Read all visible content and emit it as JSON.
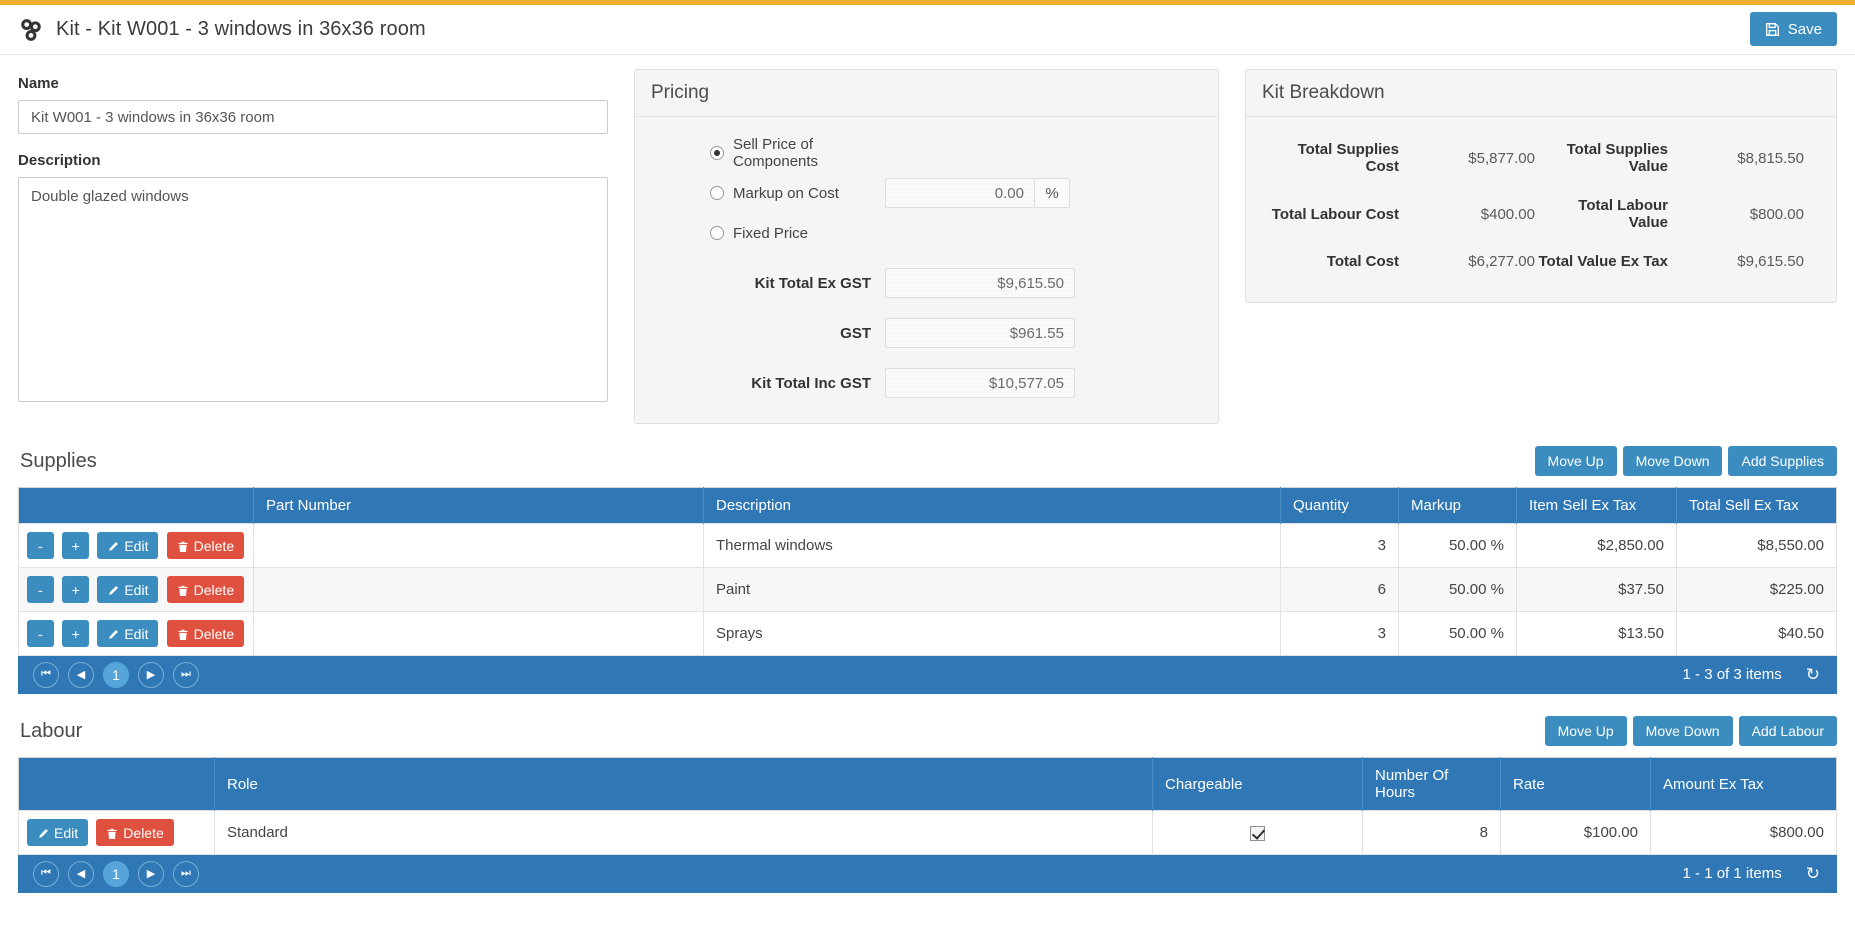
{
  "header": {
    "title": "Kit - Kit W001 - 3 windows in 36x36 room",
    "icon": "kit-cubes-icon",
    "save_label": "Save",
    "accent_color": "#f0ad2e",
    "primary_color": "#3b8cbf"
  },
  "form": {
    "name_label": "Name",
    "name_value": "Kit W001 - 3 windows in 36x36 room",
    "description_label": "Description",
    "description_value": "Double glazed windows"
  },
  "pricing": {
    "title": "Pricing",
    "options": [
      {
        "label": "Sell Price of Components",
        "selected": true
      },
      {
        "label": "Markup on Cost",
        "selected": false
      },
      {
        "label": "Fixed Price",
        "selected": false
      }
    ],
    "markup_value": "0.00",
    "markup_unit": "%",
    "fields": [
      {
        "label": "Kit Total Ex GST",
        "value": "$9,615.50"
      },
      {
        "label": "GST",
        "value": "$961.55"
      },
      {
        "label": "Kit Total Inc GST",
        "value": "$10,577.05"
      }
    ]
  },
  "breakdown": {
    "title": "Kit Breakdown",
    "rows": [
      {
        "left_label": "Total Supplies Cost",
        "left_value": "$5,877.00",
        "right_label": "Total Supplies Value",
        "right_value": "$8,815.50"
      },
      {
        "left_label": "Total Labour Cost",
        "left_value": "$400.00",
        "right_label": "Total Labour Value",
        "right_value": "$800.00"
      },
      {
        "left_label": "Total Cost",
        "left_value": "$6,277.00",
        "right_label": "Total Value Ex Tax",
        "right_value": "$9,615.50"
      }
    ]
  },
  "supplies": {
    "title": "Supplies",
    "buttons": {
      "move_up": "Move Up",
      "move_down": "Move Down",
      "add": "Add Supplies"
    },
    "row_actions": {
      "minus": "-",
      "plus": "+",
      "edit": "Edit",
      "delete": "Delete"
    },
    "columns": [
      "",
      "Part Number",
      "Description",
      "Quantity",
      "Markup",
      "Item Sell Ex Tax",
      "Total Sell Ex Tax"
    ],
    "rows": [
      {
        "part_number": "",
        "description": "Thermal windows",
        "quantity": "3",
        "markup": "50.00 %",
        "item_sell_ex_tax": "$2,850.00",
        "total_sell_ex_tax": "$8,550.00"
      },
      {
        "part_number": "",
        "description": "Paint",
        "quantity": "6",
        "markup": "50.00 %",
        "item_sell_ex_tax": "$37.50",
        "total_sell_ex_tax": "$225.00"
      },
      {
        "part_number": "",
        "description": "Sprays",
        "quantity": "3",
        "markup": "50.00 %",
        "item_sell_ex_tax": "$13.50",
        "total_sell_ex_tax": "$40.50"
      }
    ],
    "pager": {
      "current_page": "1",
      "status": "1 - 3 of 3 items"
    }
  },
  "labour": {
    "title": "Labour",
    "buttons": {
      "move_up": "Move Up",
      "move_down": "Move Down",
      "add": "Add Labour"
    },
    "row_actions": {
      "edit": "Edit",
      "delete": "Delete"
    },
    "columns": [
      "",
      "Role",
      "Chargeable",
      "Number Of Hours",
      "Rate",
      "Amount Ex Tax"
    ],
    "rows": [
      {
        "role": "Standard",
        "chargeable": true,
        "hours": "8",
        "rate": "$100.00",
        "amount_ex_tax": "$800.00"
      }
    ],
    "pager": {
      "current_page": "1",
      "status": "1 - 1 of 1 items"
    }
  },
  "pager_icons": {
    "first": "⏮",
    "prev": "◀",
    "next": "▶",
    "last": "⏭",
    "refresh": "↻"
  }
}
